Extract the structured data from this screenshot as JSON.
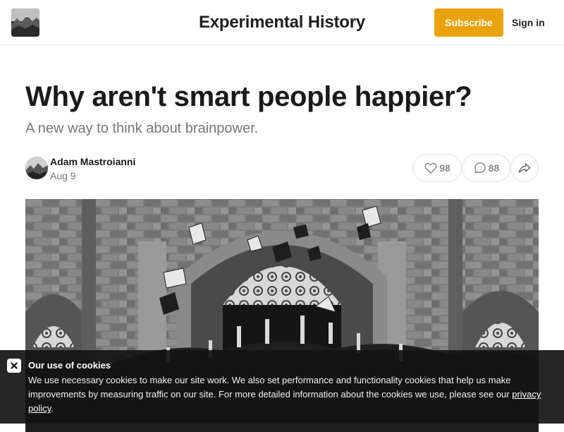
{
  "header": {
    "site_title": "Experimental History",
    "subscribe_label": "Subscribe",
    "signin_label": "Sign in",
    "logo_icon": "mountain-landscape-logo"
  },
  "post": {
    "title": "Why aren't smart people happier?",
    "subtitle": "A new way to think about brainpower.",
    "author": "Adam Mastroianni",
    "date": "Aug 9",
    "likes": "98",
    "comments": "88",
    "icons": {
      "like": "heart-icon",
      "comment": "comment-bubble-icon",
      "share": "share-arrow-icon"
    },
    "hero_image": "graduates tossing caps in front of stone building"
  },
  "cookies": {
    "title": "Our use of cookies",
    "text": "We use necessary cookies to make our site work. We also set performance and functionality cookies that help us make improvements by measuring traffic on our site. For more detailed information about the cookies we use, please see our ",
    "link_label": "privacy policy",
    "after_link": "."
  },
  "colors": {
    "accent": "#e8a20a",
    "banner": "#141414"
  }
}
